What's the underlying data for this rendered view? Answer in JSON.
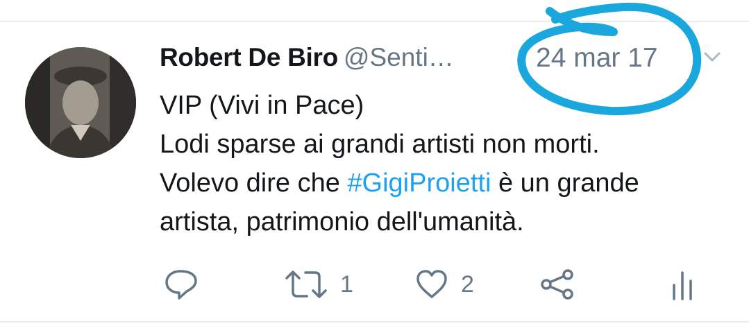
{
  "tweet": {
    "author_name": "Robert De Biro",
    "author_handle": "@Senti…",
    "date": "24 mar 17",
    "lines": [
      "VIP (Vivi in Pace)",
      "Lodi sparse ai grandi artisti non morti."
    ],
    "line3_before": "Volevo dire che ",
    "hashtag": "#GigiProietti",
    "line3_after": " è un grande",
    "line4": "artista, patrimonio dell'umanità."
  },
  "actions": {
    "reply_icon": "reply-icon",
    "retweet_icon": "retweet-icon",
    "retweet_count": "1",
    "like_icon": "heart-icon",
    "like_count": "2",
    "share_icon": "share-icon",
    "analytics_icon": "analytics-icon"
  },
  "colors": {
    "link": "#1da1f2",
    "secondary_text": "#657786",
    "annotation_circle": "#1aa7dd"
  }
}
